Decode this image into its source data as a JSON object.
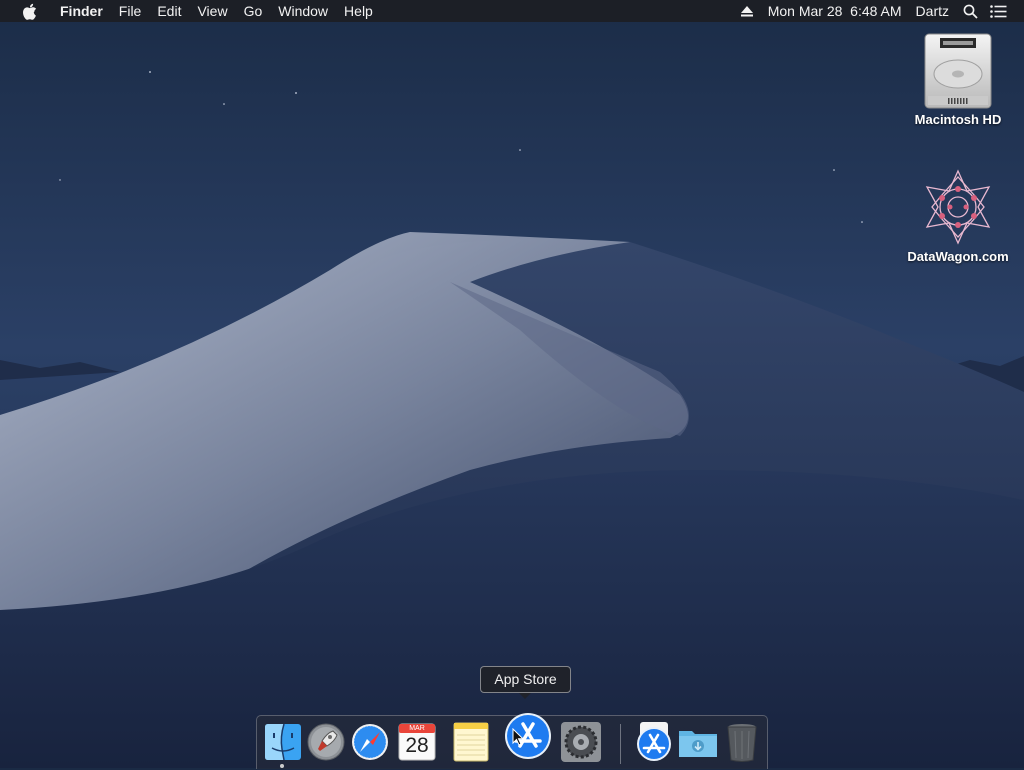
{
  "menubar": {
    "apple_icon": "apple-logo-icon",
    "app_name": "Finder",
    "menus": [
      "File",
      "Edit",
      "View",
      "Go",
      "Window",
      "Help"
    ],
    "status": {
      "eject_icon": "eject-icon",
      "datetime": "Mon Mar 28  6:48 AM",
      "user": "Dartz",
      "spotlight_icon": "search-icon",
      "notification_icon": "notification-center-icon"
    }
  },
  "desktop": {
    "icons": [
      {
        "label": "Macintosh HD",
        "icon": "hard-drive-icon"
      },
      {
        "label": "DataWagon.com",
        "icon": "datawagon-logo-icon"
      }
    ]
  },
  "dock": {
    "tooltip": "App Store",
    "apps": [
      {
        "name": "Finder",
        "icon": "finder-icon",
        "running": true
      },
      {
        "name": "Launchpad",
        "icon": "launchpad-icon"
      },
      {
        "name": "Safari",
        "icon": "safari-icon"
      },
      {
        "name": "Calendar",
        "icon": "calendar-icon",
        "month": "MAR",
        "day": "28"
      },
      {
        "name": "Notes",
        "icon": "notes-icon"
      },
      {
        "name": "App Store",
        "icon": "app-store-icon"
      },
      {
        "name": "System Preferences",
        "icon": "system-preferences-icon"
      },
      {
        "name": "App Store",
        "icon": "app-store-icon"
      },
      {
        "name": "Downloads",
        "icon": "downloads-folder-icon"
      },
      {
        "name": "Trash",
        "icon": "trash-icon"
      }
    ]
  },
  "colors": {
    "menubar_bg": "#1c1e24",
    "sky": "#223556",
    "dune_light": "#8a93a8",
    "appstore_blue": "#1e7bf0"
  }
}
